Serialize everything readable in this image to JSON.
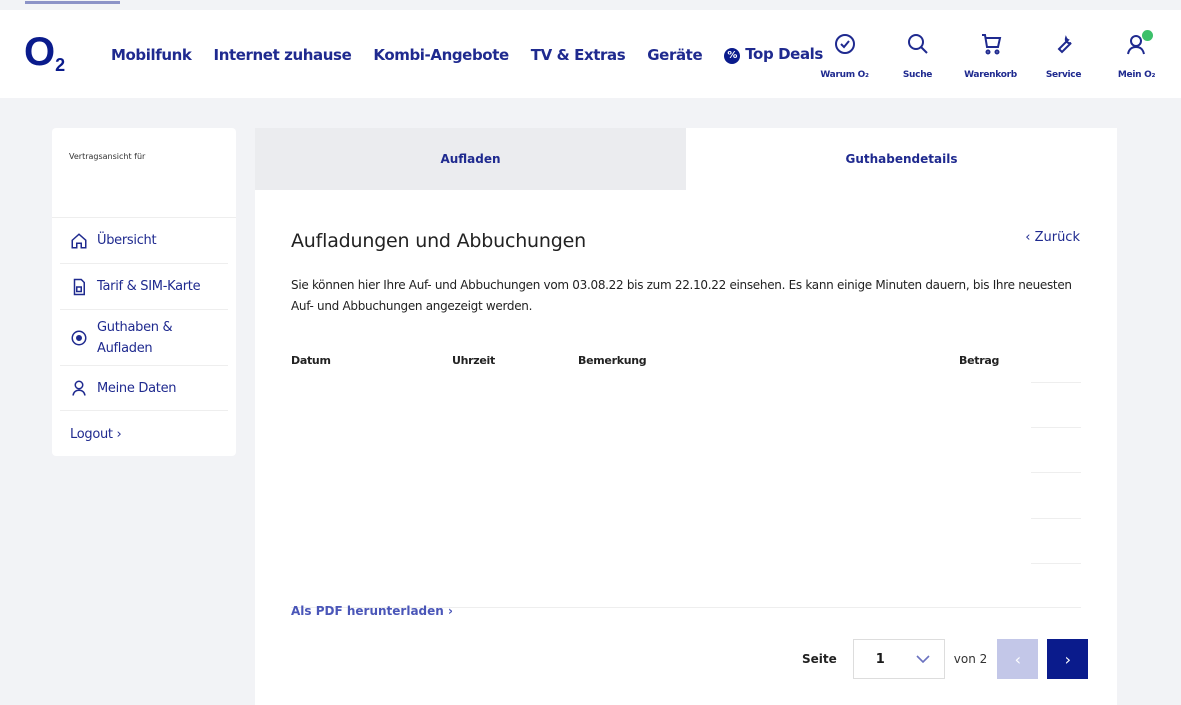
{
  "header": {
    "logo": "O",
    "logo_sub": "2",
    "nav": [
      "Mobilfunk",
      "Internet zuhause",
      "Kombi-Angebote",
      "TV & Extras",
      "Geräte",
      "Top Deals"
    ],
    "deal_badge": "%",
    "icons": [
      {
        "icon": "check-circle-icon",
        "label": "Warum O₂"
      },
      {
        "icon": "search-icon",
        "label": "Suche"
      },
      {
        "icon": "cart-icon",
        "label": "Warenkorb"
      },
      {
        "icon": "wrench-icon",
        "label": "Service"
      },
      {
        "icon": "user-icon",
        "label": "Mein O₂"
      }
    ]
  },
  "sidebar": {
    "heading": "Vertragsansicht für",
    "items": [
      {
        "label": "Übersicht",
        "icon": "home-icon"
      },
      {
        "label": "Tarif & SIM-Karte",
        "icon": "sim-icon"
      },
      {
        "label": "Guthaben & Aufladen",
        "icon": "plus-circle-icon"
      },
      {
        "label": "Meine Daten",
        "icon": "user-icon"
      },
      {
        "label": "Logout ›",
        "icon": ""
      }
    ]
  },
  "tabs": [
    "Aufladen",
    "Guthabendetails"
  ],
  "main": {
    "title": "Aufladungen und Abbuchungen",
    "back": "‹ Zurück",
    "description": "Sie können hier Ihre Auf- und Abbuchungen vom 03.08.22 bis zum 22.10.22 einsehen. Es kann einige Minuten dauern, bis Ihre neuesten Auf- und Abbuchungen angezeigt werden.",
    "columns": [
      "Datum",
      "Uhrzeit",
      "Bemerkung",
      "Betrag"
    ],
    "pdf_link": "Als PDF herunterladen ›",
    "pager": {
      "label": "Seite",
      "current": "1",
      "of": "von 2",
      "prev": "‹",
      "next": "›"
    }
  },
  "colors": {
    "brand": "#0a1b8c",
    "badge_green": "#3cc06a"
  }
}
